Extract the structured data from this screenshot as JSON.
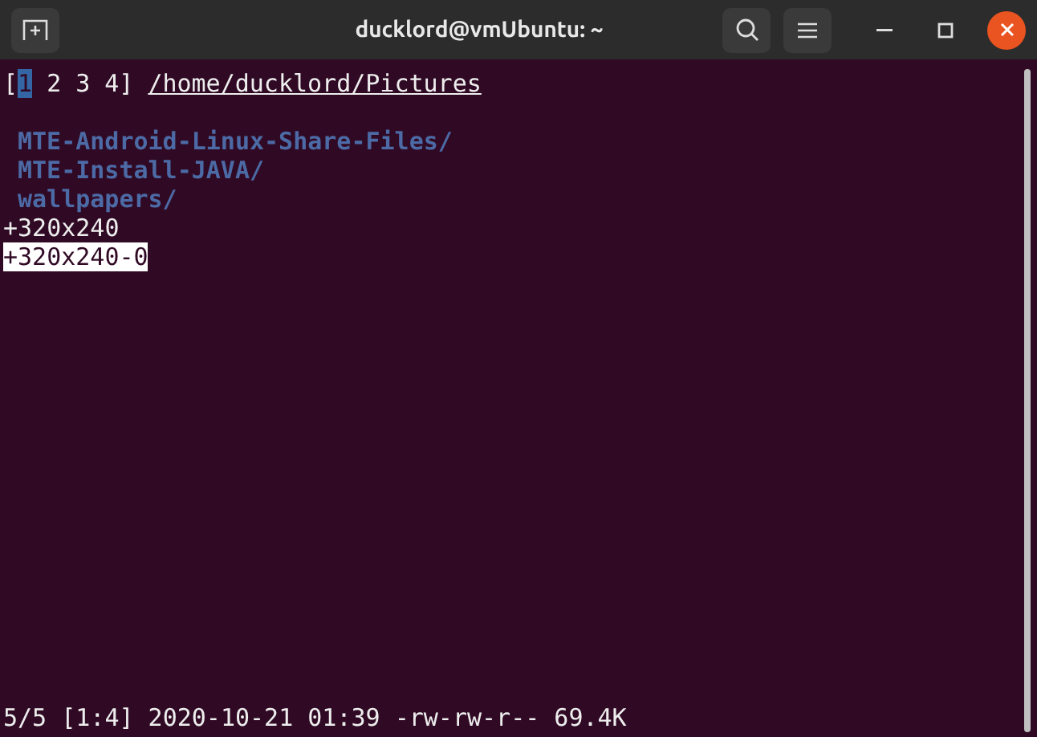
{
  "window": {
    "title": "ducklord@vmUbuntu: ~"
  },
  "tab_bar": {
    "open": "[",
    "close": "]",
    "tabs": [
      {
        "label": "1",
        "selected": true
      },
      {
        "label": "2",
        "selected": false
      },
      {
        "label": "3",
        "selected": false
      },
      {
        "label": "4",
        "selected": false
      }
    ]
  },
  "path": "/home/ducklord/Pictures",
  "entries": [
    {
      "name": "MTE-Android-Linux-Share-Files/",
      "kind": "directory",
      "selected": false
    },
    {
      "name": "MTE-Install-JAVA/",
      "kind": "directory",
      "selected": false
    },
    {
      "name": "wallpapers/",
      "kind": "directory",
      "selected": false
    },
    {
      "name": "+320x240",
      "kind": "file",
      "selected": false
    },
    {
      "name": "+320x240-0",
      "kind": "file",
      "selected": true
    }
  ],
  "status_bar": "5/5 [1:4] 2020-10-21 01:39 -rw-rw-r-- 69.4K"
}
